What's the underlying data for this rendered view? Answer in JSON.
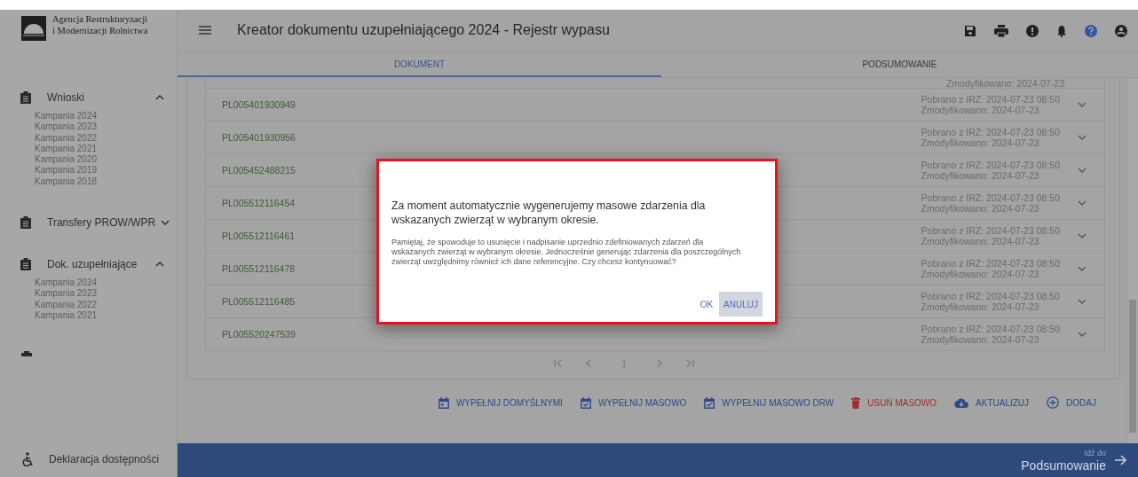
{
  "app": {
    "logo_lines": [
      "Agencja Restrukturyzacji",
      "i Modernizacji Rolnictwa"
    ],
    "title": "Kreator dokumentu uzupełniającego 2024 - Rejestr wypasu"
  },
  "sidebar": {
    "sections": [
      {
        "label": "Wnioski",
        "expanded": true,
        "items": [
          "Kampania 2024",
          "Kampania 2023",
          "Kampania 2022",
          "Kampania 2021",
          "Kampania 2020",
          "Kampania 2019",
          "Kampania 2018"
        ]
      },
      {
        "label": "Transfery PROW/WPR",
        "expanded": false
      },
      {
        "label": "Dok. uzupełniające",
        "expanded": true,
        "items": [
          "Kampania 2024",
          "Kampania 2023",
          "Kampania 2022",
          "Kampania 2021"
        ]
      }
    ],
    "footer_link": "Deklaracja dostępności"
  },
  "tabs": [
    {
      "label": "DOKUMENT",
      "selected": true
    },
    {
      "label": "PODSUMOWANIE",
      "selected": false
    }
  ],
  "table": {
    "partial_row": {
      "modified": "Zmodyfikowano: 2024-07-23"
    },
    "rows": [
      {
        "id": "PL005401930949",
        "downloaded": "Pobrano z IRZ: 2024-07-23 08:50",
        "modified": "Zmodyfikowano: 2024-07-23"
      },
      {
        "id": "PL005401930956",
        "downloaded": "Pobrano z IRZ: 2024-07-23 08:50",
        "modified": "Zmodyfikowano: 2024-07-23"
      },
      {
        "id": "PL005452488215",
        "downloaded": "Pobrano z IRZ: 2024-07-23 08:50",
        "modified": "Zmodyfikowano: 2024-07-23"
      },
      {
        "id": "PL005512116454",
        "downloaded": "Pobrano z IRZ: 2024-07-23 08:50",
        "modified": "Zmodyfikowano: 2024-07-23"
      },
      {
        "id": "PL005512116461",
        "downloaded": "Pobrano z IRZ: 2024-07-23 08:50",
        "modified": "Zmodyfikowano: 2024-07-23"
      },
      {
        "id": "PL005512116478",
        "downloaded": "Pobrano z IRZ: 2024-07-23 08:50",
        "modified": "Zmodyfikowano: 2024-07-23"
      },
      {
        "id": "PL005512116485",
        "downloaded": "Pobrano z IRZ: 2024-07-23 08:50",
        "modified": "Zmodyfikowano: 2024-07-23"
      },
      {
        "id": "PL005520247539",
        "downloaded": "Pobrano z IRZ: 2024-07-23 08:50",
        "modified": "Zmodyfikowano: 2024-07-23"
      }
    ]
  },
  "pagination": {
    "page": "1"
  },
  "toolbar": [
    {
      "label": "WYPEŁNIJ DOMYŚLNYMI",
      "kind": "calendar",
      "color": "#2f4a86"
    },
    {
      "label": "WYPEŁNIJ MASOWO",
      "kind": "check",
      "color": "#2f4a86"
    },
    {
      "label": "WYPEŁNIJ MASOWO DRW",
      "kind": "check",
      "color": "#2f4a86"
    },
    {
      "label": "USUŃ MASOWO",
      "kind": "trash",
      "color": "#a02c2c"
    },
    {
      "label": "AKTUALIZUJ",
      "kind": "cloud",
      "color": "#2f4a86"
    },
    {
      "label": "DODAJ",
      "kind": "plus",
      "color": "#2f4a86"
    }
  ],
  "footer": {
    "hint": "Idź do",
    "target": "Podsumowanie"
  },
  "dialog": {
    "title": "Za moment automatycznie wygenerujemy masowe zdarzenia dla wskazanych zwierząt w wybranym okresie.",
    "message": "Pamiętaj, że spowoduje to usunięcie i nadpisanie uprzednio zdefiniowanych zdarzeń dla wskazanych zwierząt w wybranym okresie. Jednocześnie generując zdarzenia dla poszczególnych zwierząt uwzględnimy również ich dane referencyjne. Czy chcesz kontynuować?",
    "buttons": [
      {
        "label": "OK",
        "focused": false
      },
      {
        "label": "ANULUJ",
        "focused": true
      }
    ]
  }
}
